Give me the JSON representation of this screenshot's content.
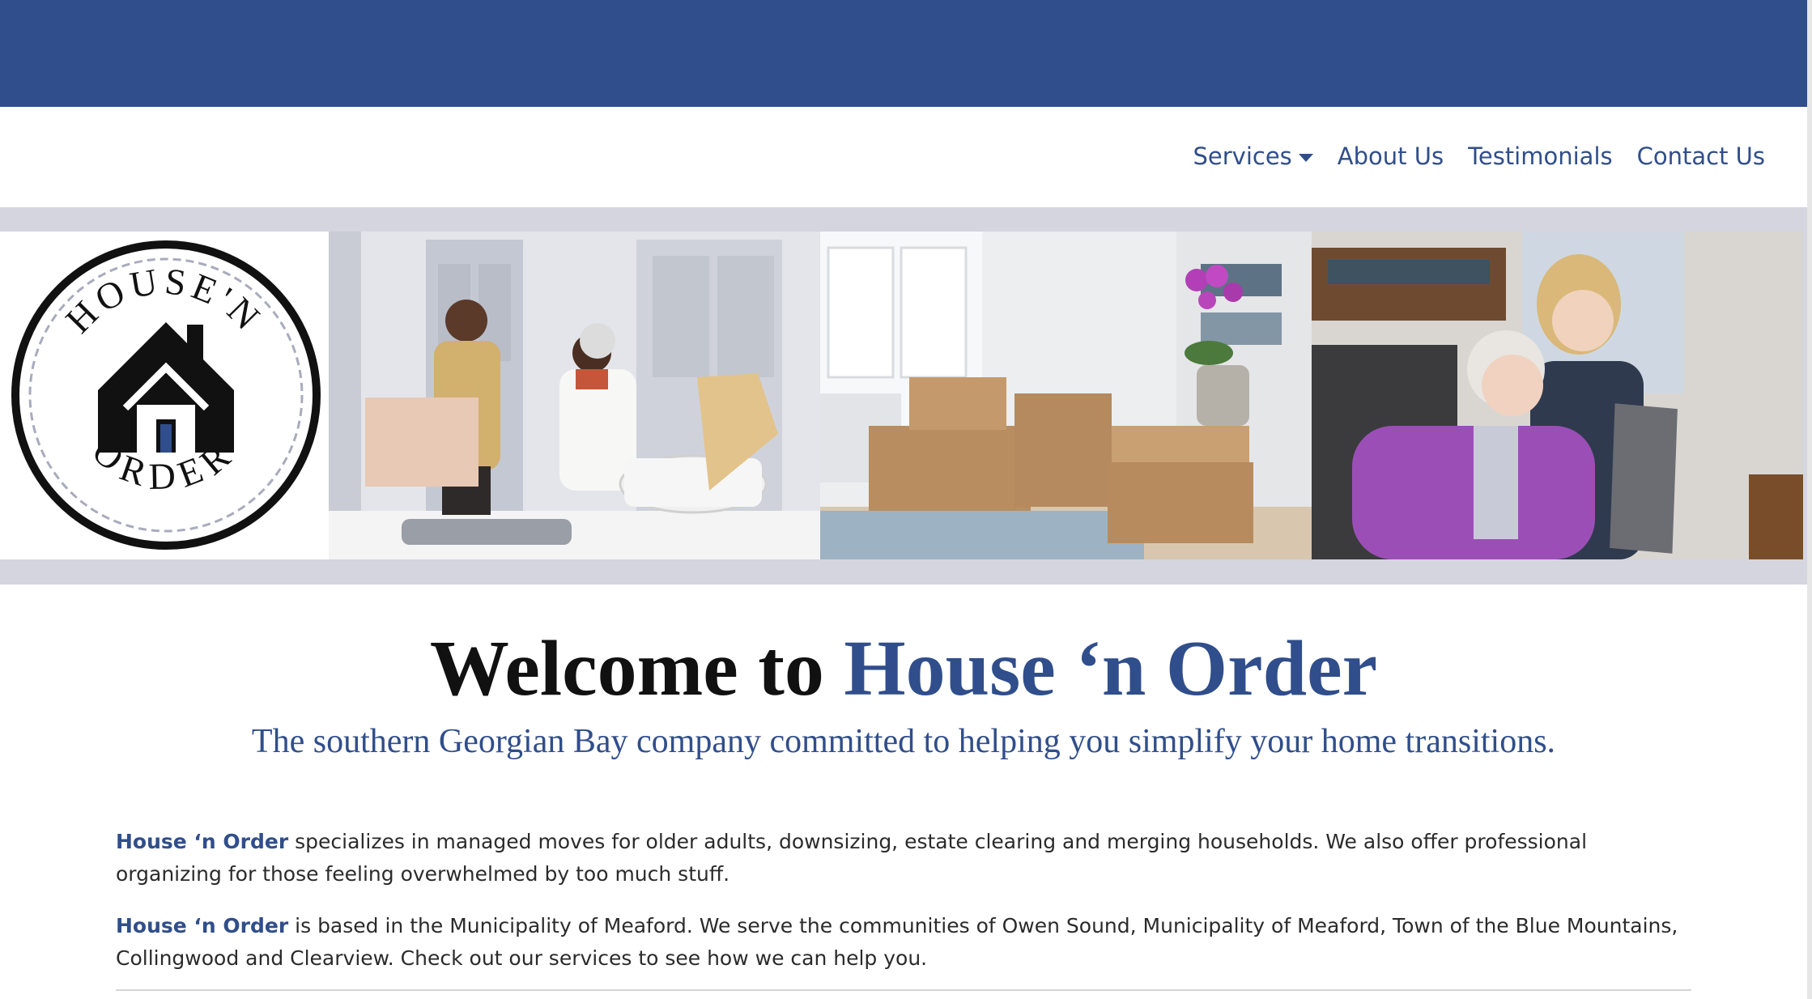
{
  "colors": {
    "brand": "#304e8b",
    "band": "#d4d5df"
  },
  "logo": {
    "top_text": "HOUSE'N",
    "bottom_text": "ORDER"
  },
  "nav": {
    "items": [
      {
        "label": "Services",
        "has_dropdown": true
      },
      {
        "label": "About Us"
      },
      {
        "label": "Testimonials"
      },
      {
        "label": "Contact Us"
      }
    ]
  },
  "banner": {
    "photos": [
      "couple-moving-boxes",
      "moving-boxes-living-room",
      "grandmother-and-girl-tablet"
    ]
  },
  "hero": {
    "title_prefix": "Welcome to ",
    "title_brand": "House ‘n Order",
    "subtitle": "The southern Georgian Bay company committed to helping you simplify your home transitions."
  },
  "content": {
    "p1_brand": "House ‘n Order",
    "p1_text": " specializes in managed moves for older adults, downsizing, estate clearing and merging households. We also offer professional organizing for those feeling overwhelmed by too much stuff.",
    "p2_brand": "House ‘n Order",
    "p2_text": " is based in the Municipality of Meaford. We serve the communities of Owen Sound, Municipality of Meaford, Town of the Blue Mountains, Collingwood and Clearview. Check out our services to see how we can help you."
  }
}
